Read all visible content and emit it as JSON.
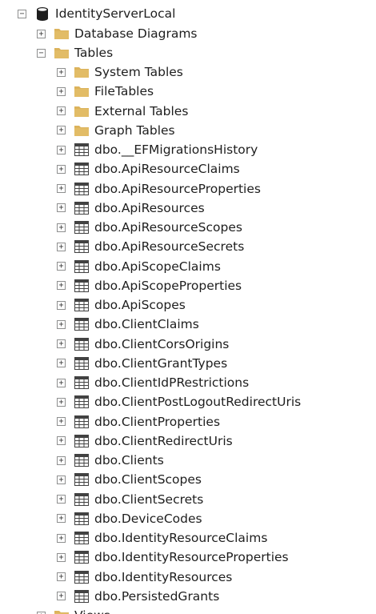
{
  "root": {
    "label": "IdentityServerLocal",
    "icon": "database-icon",
    "expander": "−"
  },
  "database_diagrams": {
    "label": "Database Diagrams",
    "icon": "folder-icon",
    "expander": "+"
  },
  "tables": {
    "label": "Tables",
    "icon": "folder-icon",
    "expander": "−"
  },
  "table_folders": [
    {
      "label": "System Tables",
      "icon": "folder-icon",
      "expander": "+"
    },
    {
      "label": "FileTables",
      "icon": "folder-icon",
      "expander": "+"
    },
    {
      "label": "External Tables",
      "icon": "folder-icon",
      "expander": "+"
    },
    {
      "label": "Graph Tables",
      "icon": "folder-icon",
      "expander": "+"
    }
  ],
  "table_items": [
    {
      "label": "dbo.__EFMigrationsHistory",
      "icon": "table-icon",
      "expander": "+"
    },
    {
      "label": "dbo.ApiResourceClaims",
      "icon": "table-icon",
      "expander": "+"
    },
    {
      "label": "dbo.ApiResourceProperties",
      "icon": "table-icon",
      "expander": "+"
    },
    {
      "label": "dbo.ApiResources",
      "icon": "table-icon",
      "expander": "+"
    },
    {
      "label": "dbo.ApiResourceScopes",
      "icon": "table-icon",
      "expander": "+"
    },
    {
      "label": "dbo.ApiResourceSecrets",
      "icon": "table-icon",
      "expander": "+"
    },
    {
      "label": "dbo.ApiScopeClaims",
      "icon": "table-icon",
      "expander": "+"
    },
    {
      "label": "dbo.ApiScopeProperties",
      "icon": "table-icon",
      "expander": "+"
    },
    {
      "label": "dbo.ApiScopes",
      "icon": "table-icon",
      "expander": "+"
    },
    {
      "label": "dbo.ClientClaims",
      "icon": "table-icon",
      "expander": "+"
    },
    {
      "label": "dbo.ClientCorsOrigins",
      "icon": "table-icon",
      "expander": "+"
    },
    {
      "label": "dbo.ClientGrantTypes",
      "icon": "table-icon",
      "expander": "+"
    },
    {
      "label": "dbo.ClientIdPRestrictions",
      "icon": "table-icon",
      "expander": "+"
    },
    {
      "label": "dbo.ClientPostLogoutRedirectUris",
      "icon": "table-icon",
      "expander": "+"
    },
    {
      "label": "dbo.ClientProperties",
      "icon": "table-icon",
      "expander": "+"
    },
    {
      "label": "dbo.ClientRedirectUris",
      "icon": "table-icon",
      "expander": "+"
    },
    {
      "label": "dbo.Clients",
      "icon": "table-icon",
      "expander": "+"
    },
    {
      "label": "dbo.ClientScopes",
      "icon": "table-icon",
      "expander": "+"
    },
    {
      "label": "dbo.ClientSecrets",
      "icon": "table-icon",
      "expander": "+"
    },
    {
      "label": "dbo.DeviceCodes",
      "icon": "table-icon",
      "expander": "+"
    },
    {
      "label": "dbo.IdentityResourceClaims",
      "icon": "table-icon",
      "expander": "+"
    },
    {
      "label": "dbo.IdentityResourceProperties",
      "icon": "table-icon",
      "expander": "+"
    },
    {
      "label": "dbo.IdentityResources",
      "icon": "table-icon",
      "expander": "+"
    },
    {
      "label": "dbo.PersistedGrants",
      "icon": "table-icon",
      "expander": "+"
    }
  ],
  "partial_bottom": {
    "label": "Views",
    "icon": "folder-icon",
    "expander": "+"
  },
  "colors": {
    "folder": "#dcb35c",
    "table_outline": "#424242",
    "text": "#1e1e1e"
  }
}
